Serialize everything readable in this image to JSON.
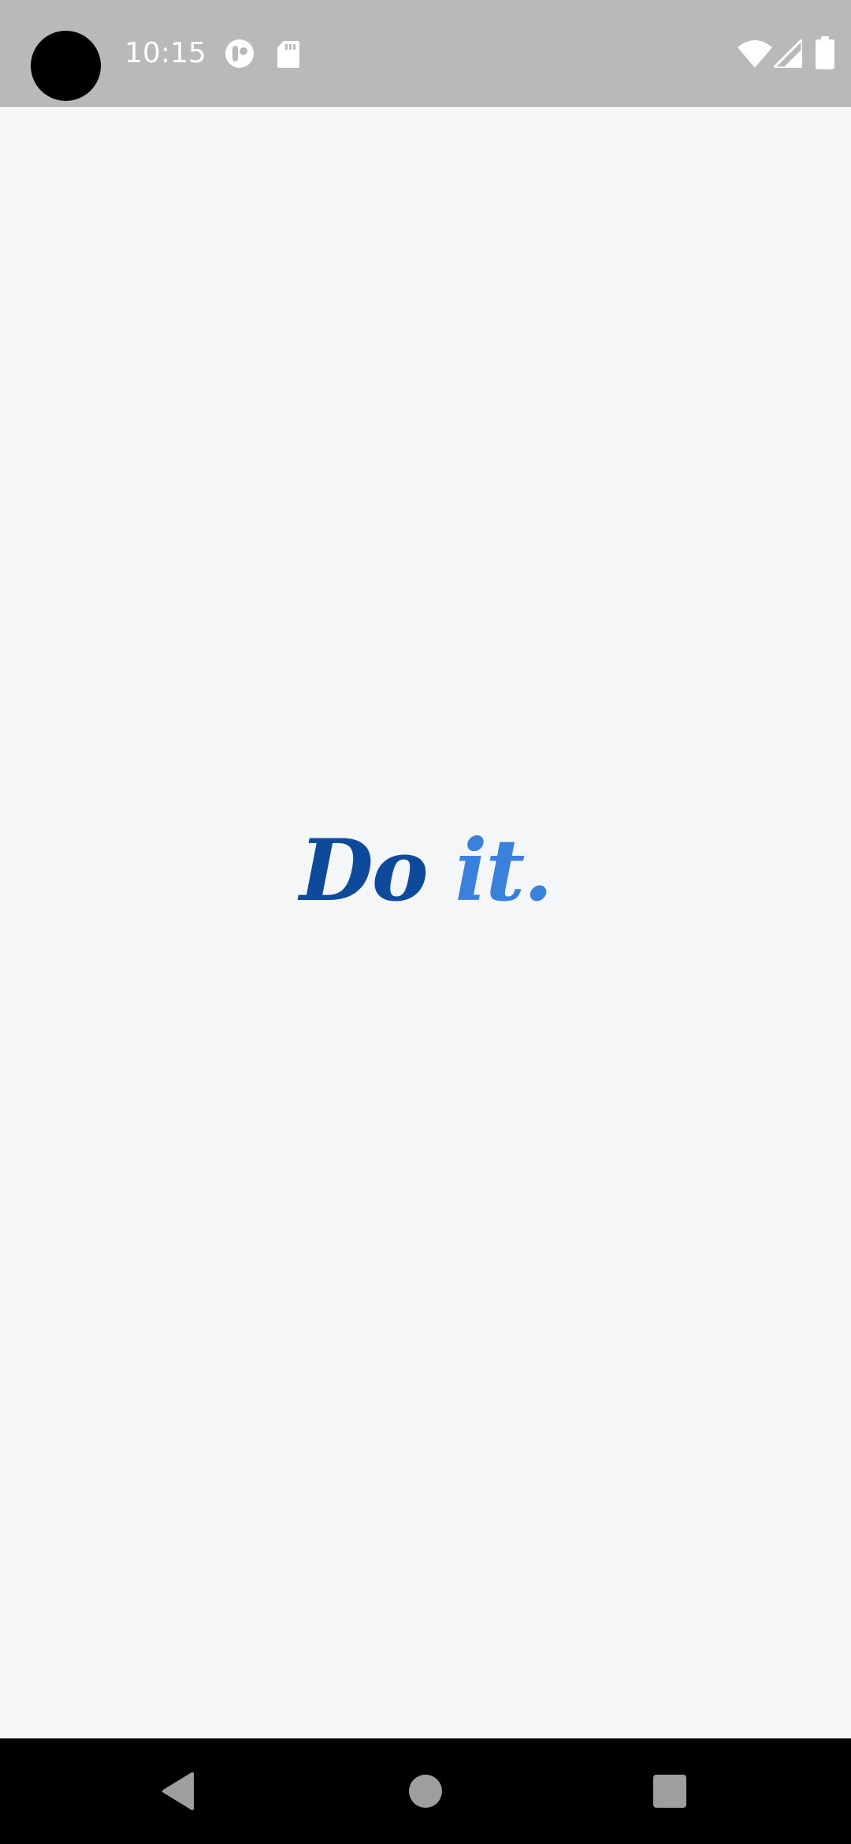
{
  "status_bar": {
    "time": "10:15",
    "icons": [
      "camera-cutout",
      "notification-app-icon",
      "sd-card-icon",
      "wifi-icon",
      "cell-signal-icon",
      "battery-icon"
    ]
  },
  "splash": {
    "logo_part1": "Do",
    "logo_space": " ",
    "logo_part2": "it."
  },
  "nav_bar": {
    "buttons": [
      "back",
      "home",
      "recents"
    ]
  },
  "colors": {
    "background": "#F5F6F8",
    "status_bar": "#B8B9BB",
    "logo_dark_blue": "#0E4A9B",
    "logo_light_blue": "#3A80DD",
    "nav_bar": "#000000",
    "nav_icon": "#9E9E9E"
  }
}
